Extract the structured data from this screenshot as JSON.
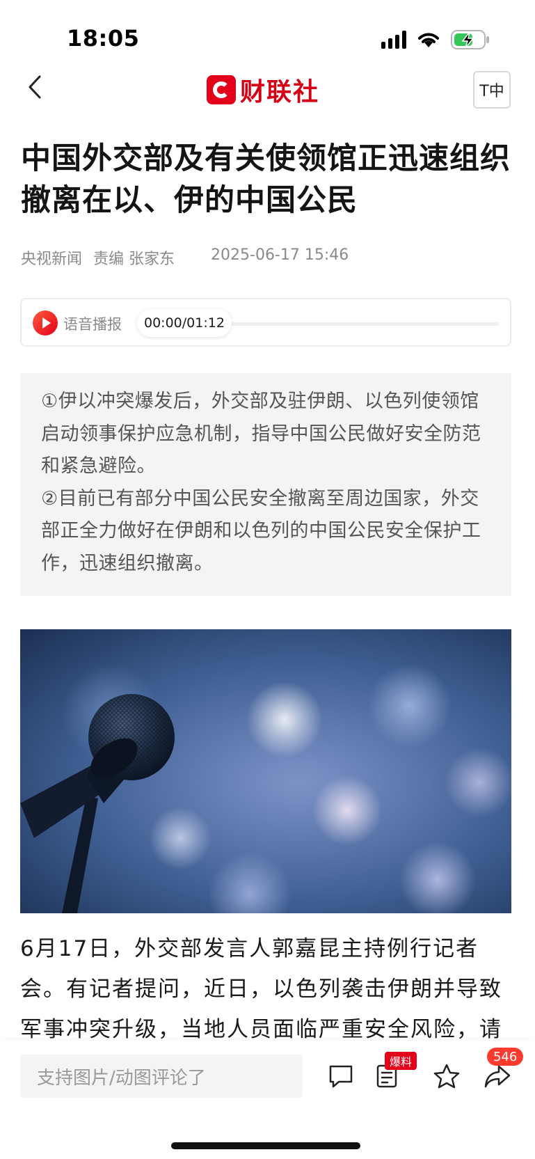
{
  "status_bar": {
    "time": "18:05",
    "icons": [
      "signal-icon",
      "wifi-icon",
      "battery-charging-icon"
    ]
  },
  "nav": {
    "back_icon": "chevron-left-icon",
    "brand": "财联社",
    "font_size_label": "T中"
  },
  "article": {
    "title": "中国外交部及有关使领馆正迅速组织撤离在以、伊的中国公民",
    "source": "央视新闻",
    "editor": "责编 张家东",
    "datetime": "2025-06-17 15:46",
    "audio": {
      "label": "语音播报",
      "time": "00:00/01:12"
    },
    "summary": [
      "①伊以冲突爆发后，外交部及驻伊朗、以色列使领馆启动领事保护应急机制，指导中国公民做好安全防范和紧急避险。",
      "②目前已有部分中国公民安全撤离至周边国家，外交部正全力做好在伊朗和以色列的中国公民安全保护工作，迅速组织撤离。"
    ],
    "body": "6月17日，外交部发言人郭嘉昆主持例行记者会。有记者提问，近日，以色列袭击伊朗并导致军事冲突升级，当地人员面临严重安全风险，请"
  },
  "bottom_bar": {
    "comment_placeholder": "支持图片/动图评论了",
    "report_badge": "爆料",
    "share_count": "546",
    "icons": [
      "comment-icon",
      "report-icon",
      "star-icon",
      "share-icon"
    ]
  },
  "colors": {
    "brand_red": "#e3001b",
    "summary_bg": "#f4f4f4",
    "meta_gray": "#8a8a8a"
  }
}
